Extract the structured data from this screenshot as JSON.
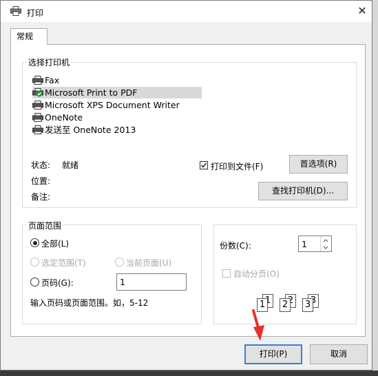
{
  "window": {
    "title": "打印",
    "close_glyph": "✕"
  },
  "tabs": [
    {
      "label": "常规",
      "active": true
    }
  ],
  "printer_group": {
    "title": "选择打印机",
    "printers": [
      {
        "name": "Fax",
        "selected": false
      },
      {
        "name": "Microsoft Print to PDF",
        "selected": true
      },
      {
        "name": "Microsoft XPS Document Writer",
        "selected": false
      },
      {
        "name": "OneNote",
        "selected": false
      },
      {
        "name": "发送至 OneNote 2013",
        "selected": false
      }
    ],
    "status_label": "状态:",
    "status_value": "就绪",
    "location_label": "位置:",
    "comment_label": "备注:",
    "print_to_file_label": "打印到文件(F)",
    "print_to_file_checked": true,
    "preferences_button": "首选项(R)",
    "find_printer_button": "查找打印机(D)..."
  },
  "page_range": {
    "title": "页面范围",
    "all_label": "全部(L)",
    "selection_label": "选定范围(T)",
    "current_page_label": "当前页面(U)",
    "pages_label": "页码(G):",
    "pages_value": "1",
    "hint": "输入页码或页面范围。如，5-12",
    "selected_option": "all"
  },
  "copies": {
    "label": "份数(C):",
    "value": "1",
    "collate_label": "自动分页(O)",
    "collate_checked": false,
    "collate_pages": [
      "1",
      "1",
      "2",
      "2",
      "3",
      "3"
    ]
  },
  "footer": {
    "print_button": "打印(P)",
    "cancel_button": "取消"
  },
  "colors": {
    "selection_bg": "#d9d9d9",
    "primary_border": "#3d7bd6",
    "annotation_arrow": "#e8302b",
    "check_green": "#1a9e3a"
  }
}
